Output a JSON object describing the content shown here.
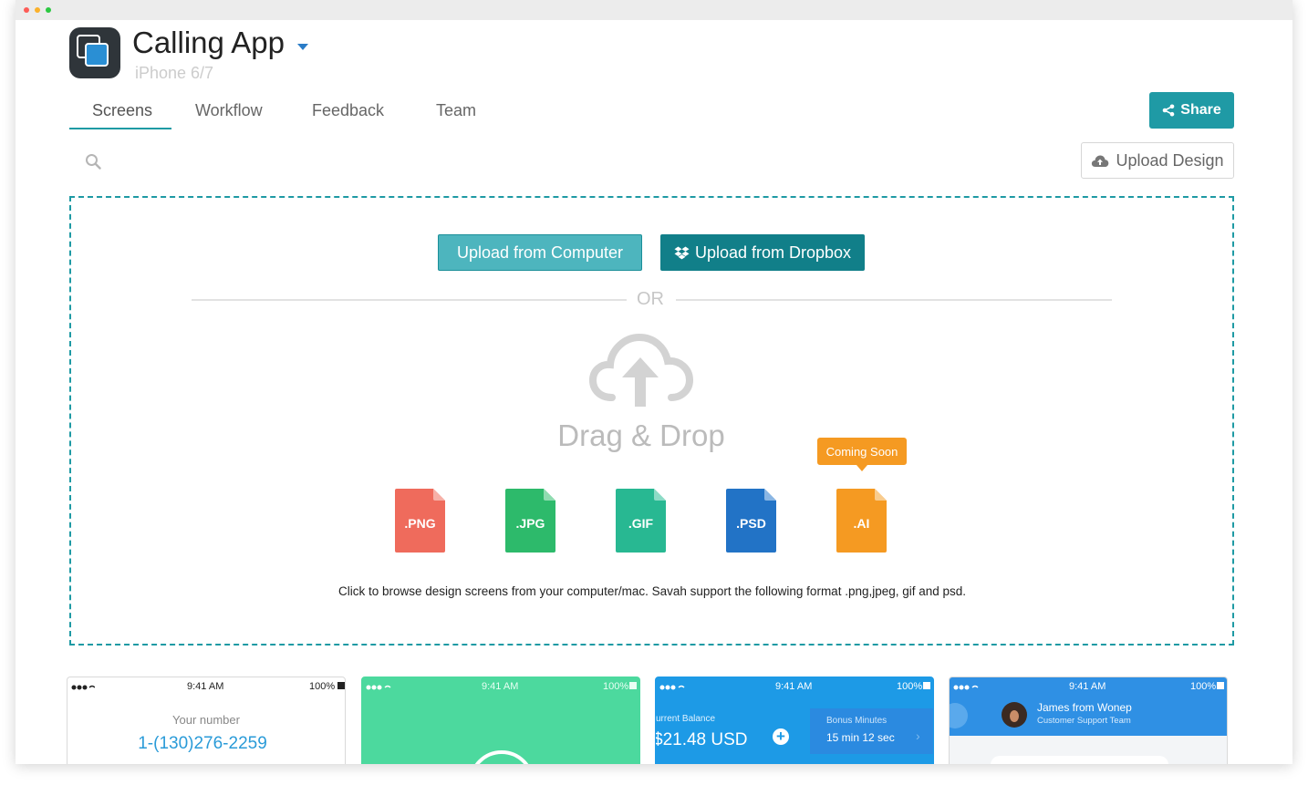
{
  "app": {
    "title": "Calling App",
    "subtitle": "iPhone 6/7"
  },
  "tabs": [
    {
      "label": "Screens",
      "active": true
    },
    {
      "label": "Workflow",
      "active": false
    },
    {
      "label": "Feedback",
      "active": false
    },
    {
      "label": "Team",
      "active": false
    }
  ],
  "actions": {
    "share_label": "Share",
    "upload_design_label": "Upload Design"
  },
  "dropzone": {
    "upload_computer_label": "Upload from Computer",
    "upload_dropbox_label": "Upload from Dropbox",
    "or_text": "OR",
    "drag_drop_text": "Drag & Drop",
    "coming_soon_text": "Coming Soon",
    "formats": [
      ".PNG",
      ".JPG",
      ".GIF",
      ".PSD",
      ".AI"
    ],
    "caption": "Click to browse design screens from your computer/mac. Savah support the following format .png,jpeg, gif and psd."
  },
  "thumbnails": [
    {
      "time": "9:41 AM",
      "battery": "100%",
      "label": "Your number",
      "value": "1-(130)276-2259"
    },
    {
      "time": "9:41 AM",
      "battery": "100%"
    },
    {
      "time": "9:41 AM",
      "battery": "100%",
      "balance_label": "urrent Balance",
      "balance_value": "$21.48 USD",
      "bonus_label": "Bonus Minutes",
      "bonus_value": "15 min 12 sec"
    },
    {
      "time": "9:41 AM",
      "battery": "100%",
      "contact_name": "James from Wonep",
      "contact_role": "Customer Support Team"
    }
  ],
  "colors": {
    "accent": "#1e9aa4",
    "dropbox_button": "#117f89",
    "computer_button": "#4db5be",
    "png": "#ef6b5c",
    "jpg": "#2dba6b",
    "gif": "#28b892",
    "psd": "#2273c6",
    "ai": "#f59a22"
  },
  "icons": [
    "share-icon",
    "search-icon",
    "cloud-upload-icon",
    "dropbox-icon",
    "chevron-down-icon"
  ]
}
